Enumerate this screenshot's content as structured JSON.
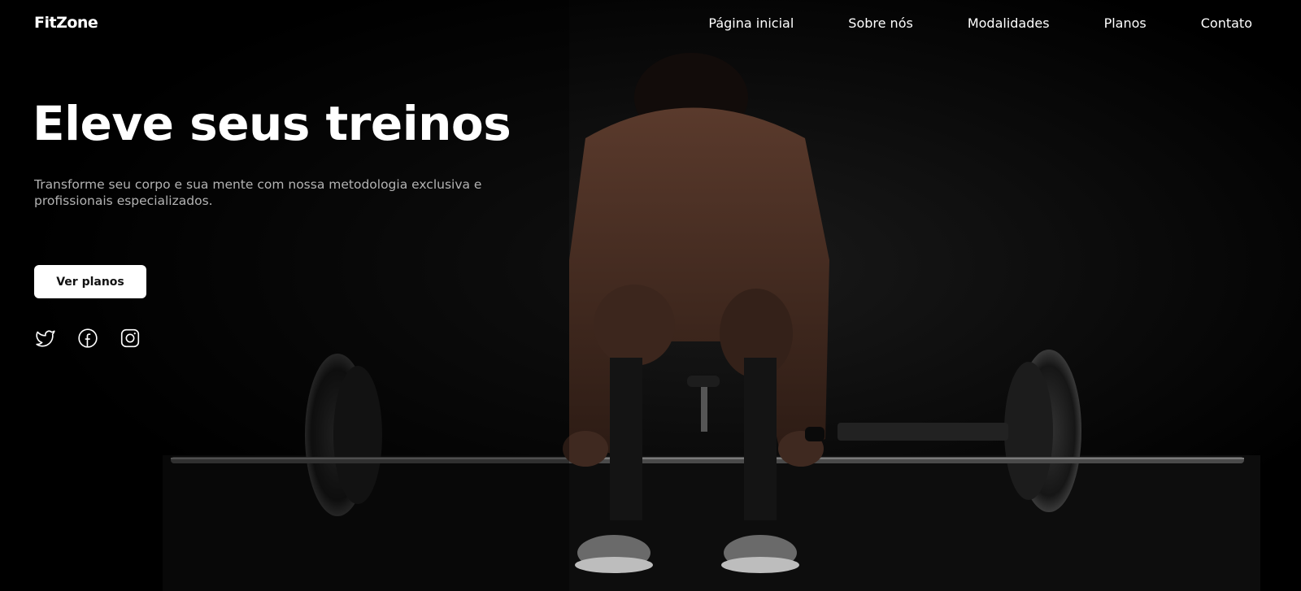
{
  "brand": {
    "logo": "FitZone"
  },
  "nav": {
    "items": [
      {
        "label": "Página inicial"
      },
      {
        "label": "Sobre nós"
      },
      {
        "label": "Modalidades"
      },
      {
        "label": "Planos"
      },
      {
        "label": "Contato"
      }
    ]
  },
  "hero": {
    "title": "Eleve seus treinos",
    "subtitle": "Transforme seu corpo e sua mente com nossa metodologia exclusiva e profissionais especializados.",
    "cta_label": "Ver planos"
  },
  "social": {
    "icons": [
      "twitter-icon",
      "facebook-icon",
      "instagram-icon"
    ]
  },
  "colors": {
    "background": "#000000",
    "text": "#ffffff",
    "subtitle": "#b3b3b3",
    "button_bg": "#ffffff",
    "button_text": "#111111"
  }
}
